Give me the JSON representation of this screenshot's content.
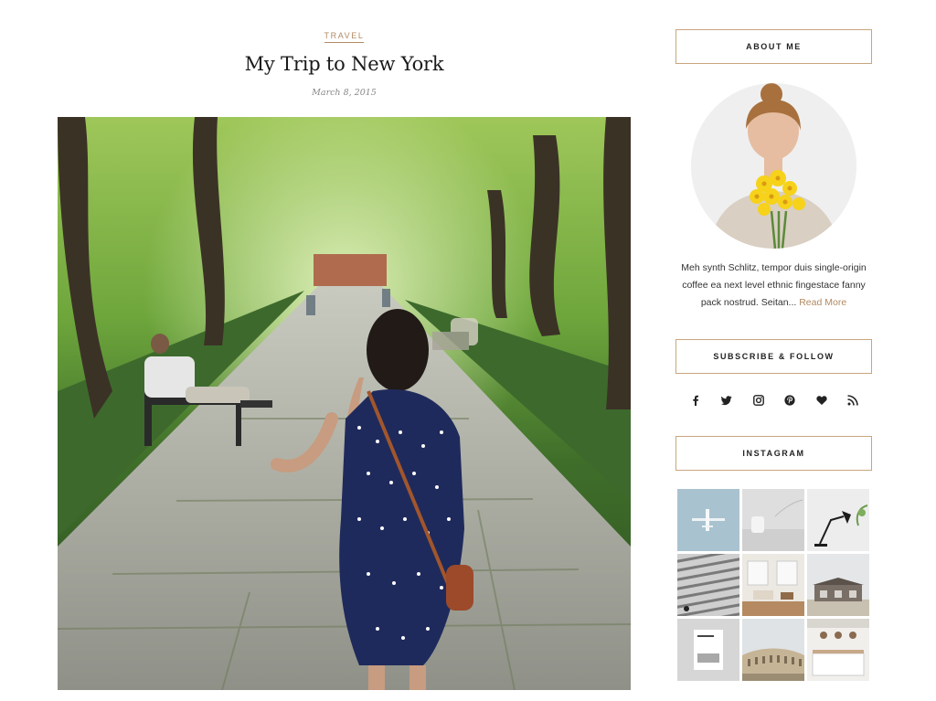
{
  "post": {
    "category": "TRAVEL",
    "title": "My Trip to New York",
    "date": "March 8, 2015"
  },
  "sidebar": {
    "about": {
      "title": "ABOUT ME",
      "text": "Meh synth Schlitz, tempor duis single-origin coffee ea next level ethnic fingestace fanny pack nostrud. Seitan...",
      "read_more": "Read More"
    },
    "follow": {
      "title": "SUBSCRIBE & FOLLOW",
      "icons": [
        "facebook-icon",
        "twitter-icon",
        "instagram-icon",
        "pinterest-icon",
        "heart-icon",
        "rss-icon"
      ]
    },
    "instagram": {
      "title": "INSTAGRAM",
      "tiles": [
        "airplane",
        "speaker",
        "desk-lamp",
        "architecture-stripes",
        "living-room",
        "house",
        "book",
        "townhouses",
        "kitchen"
      ]
    }
  },
  "colors": {
    "accent": "#b18a63",
    "border": "#c9a57f"
  }
}
